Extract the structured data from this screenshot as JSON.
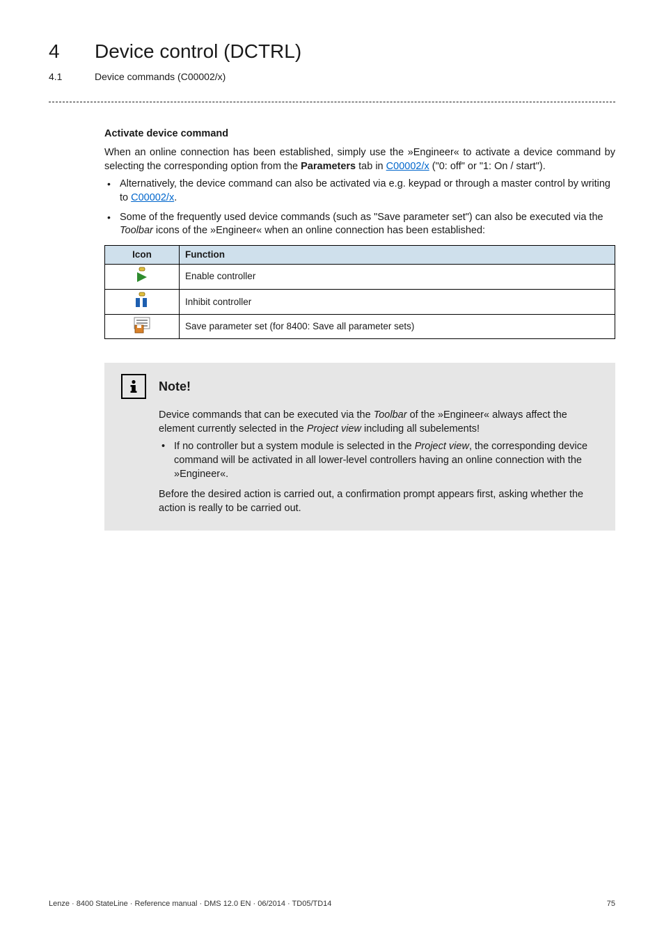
{
  "header": {
    "section_number": "4",
    "section_title": "Device control (DCTRL)",
    "subsection_number": "4.1",
    "subsection_title": "Device commands (C00002/x)"
  },
  "body": {
    "heading": "Activate device command",
    "para_intro_pre": "When an online connection has been established, simply use the »Engineer« to activate a device command by selecting the corresponding option from the ",
    "para_intro_bold": "Parameters",
    "para_intro_mid": " tab in ",
    "para_intro_link": "C00002/x",
    "para_intro_post": " (\"0: off\" or \"1: On / start\").",
    "bullet1_pre": "Alternatively, the device command can also be activated via e.g. keypad or through a master control by writing to ",
    "bullet1_link": "C00002/x",
    "bullet1_post": ".",
    "bullet2": "Some of the frequently used device commands (such as \"Save parameter set\") can also be executed via the ",
    "bullet2_italic": "Toolbar",
    "bullet2_mid": " icons of the »Engineer« when an online connection has been established:"
  },
  "table": {
    "headers": {
      "icon": "Icon",
      "function": "Function"
    },
    "rows": [
      {
        "icon_name": "enable-controller-icon",
        "function": "Enable controller"
      },
      {
        "icon_name": "inhibit-controller-icon",
        "function": "Inhibit controller"
      },
      {
        "icon_name": "save-parameter-set-icon",
        "function": "Save parameter set (for 8400: Save all parameter sets)"
      }
    ]
  },
  "note": {
    "title": "Note!",
    "para1_pre": "Device commands that can be executed via the ",
    "para1_italic1": "Toolbar",
    "para1_mid": " of the »Engineer« always affect the element currently selected in the ",
    "para1_italic2": "Project view",
    "para1_post": " including all subelements!",
    "bullet_pre": "If no controller but a system module is selected in the ",
    "bullet_italic": "Project view",
    "bullet_post": ", the corresponding device command will be activated in all lower-level controllers having an online connection with the »Engineer«.",
    "para2": "Before the desired action is carried out, a confirmation prompt appears first, asking whether the action is really to be carried out."
  },
  "footer": {
    "text": "Lenze · 8400 StateLine · Reference manual · DMS 12.0 EN · 06/2014 · TD05/TD14",
    "page": "75"
  }
}
